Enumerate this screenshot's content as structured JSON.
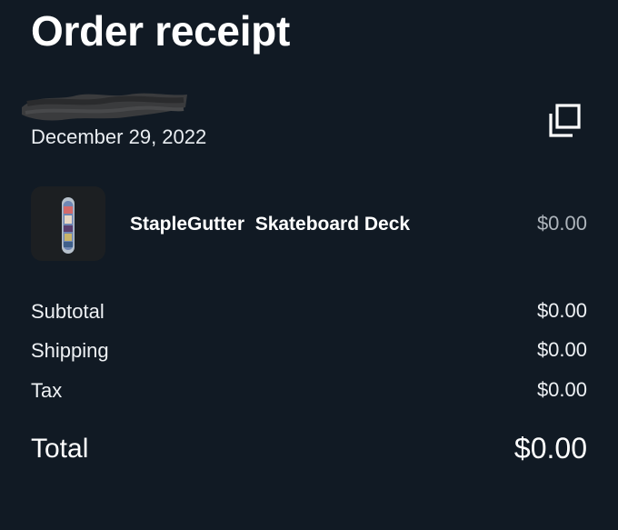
{
  "receipt": {
    "title": "Order receipt",
    "date": "December 29, 2022"
  },
  "icons": {
    "copy": "copy-icon",
    "product": "skateboard-deck"
  },
  "item": {
    "name": "StapleGutter  Skateboard Deck",
    "price": "$0.00"
  },
  "summary": {
    "subtotal_label": "Subtotal",
    "subtotal_value": "$0.00",
    "shipping_label": "Shipping",
    "shipping_value": "$0.00",
    "tax_label": "Tax",
    "tax_value": "$0.00",
    "total_label": "Total",
    "total_value": "$0.00"
  },
  "colors": {
    "background": "#111a24",
    "text": "#ffffff",
    "muted": "#aeb5bc"
  }
}
